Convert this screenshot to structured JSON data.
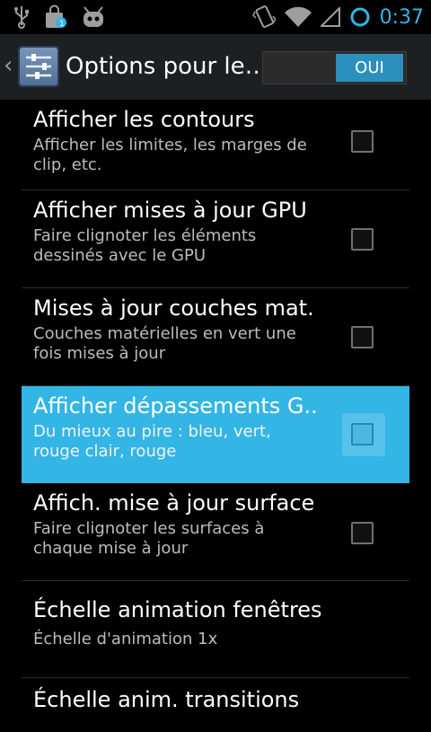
{
  "status_bar": {
    "left_icons": [
      "usb-icon",
      "shopping-bag-notification-icon",
      "cyanogenmod-mascot-icon"
    ],
    "right_icons": [
      "vibrate-icon",
      "wifi-icon",
      "signal-icon",
      "sync-ring-icon"
    ],
    "time": "0:37",
    "time_color": "#33b5e5"
  },
  "action_bar": {
    "up_glyph": "‹",
    "icon": "settings-sliders-icon",
    "title": "Options pour le…",
    "toggle_on_label": "OUI"
  },
  "items": [
    {
      "title": "Afficher les contours",
      "summary": "Afficher les limites, les marges de clip, etc.",
      "checked": false,
      "selected": false
    },
    {
      "title": "Afficher mises à jour GPU",
      "summary": "Faire clignoter les éléments dessinés avec le GPU",
      "checked": false,
      "selected": false
    },
    {
      "title": "Mises à jour couches mat.",
      "summary": "Couches matérielles en vert une fois mises à jour",
      "checked": false,
      "selected": false
    },
    {
      "title": "Afficher dépassements G..",
      "summary": "Du mieux au pire : bleu, vert, rouge clair, rouge",
      "checked": false,
      "selected": true
    },
    {
      "title": "Affich. mise à jour surface",
      "summary": "Faire clignoter les surfaces à chaque mise à jour",
      "checked": false,
      "selected": false
    },
    {
      "title": "Échelle animation fenêtres",
      "summary": "Échelle d'animation 1x",
      "checked": null,
      "selected": false
    },
    {
      "title": "Échelle anim. transitions",
      "summary": "",
      "checked": null,
      "selected": false
    }
  ],
  "colors": {
    "accent": "#33b5e5",
    "selected_row": "#33b5e5",
    "toggle_on": "#2b90be"
  }
}
